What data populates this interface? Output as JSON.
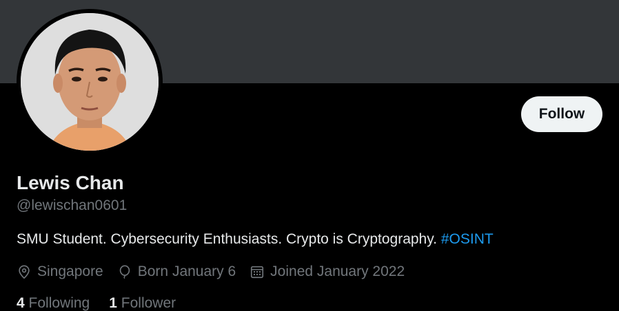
{
  "profile": {
    "name": "Lewis Chan",
    "handle": "@lewischan0601",
    "bio_text": "SMU Student. Cybersecurity Enthusiasts. Crypto is Cryptography. ",
    "bio_hashtag": "#OSINT",
    "location": "Singapore",
    "birthday": "Born January 6",
    "joined": "Joined January 2022"
  },
  "actions": {
    "follow_label": "Follow"
  },
  "stats": {
    "following_count": "4",
    "following_label": "Following",
    "followers_count": "1",
    "followers_label": "Follower"
  },
  "icons": {
    "location": "location-pin-icon",
    "birthday": "balloon-icon",
    "joined": "calendar-icon"
  },
  "colors": {
    "background": "#000000",
    "banner": "#333639",
    "text_primary": "#e7e9ea",
    "text_secondary": "#71767b",
    "accent": "#1d9bf0",
    "follow_button_bg": "#eff3f4"
  }
}
